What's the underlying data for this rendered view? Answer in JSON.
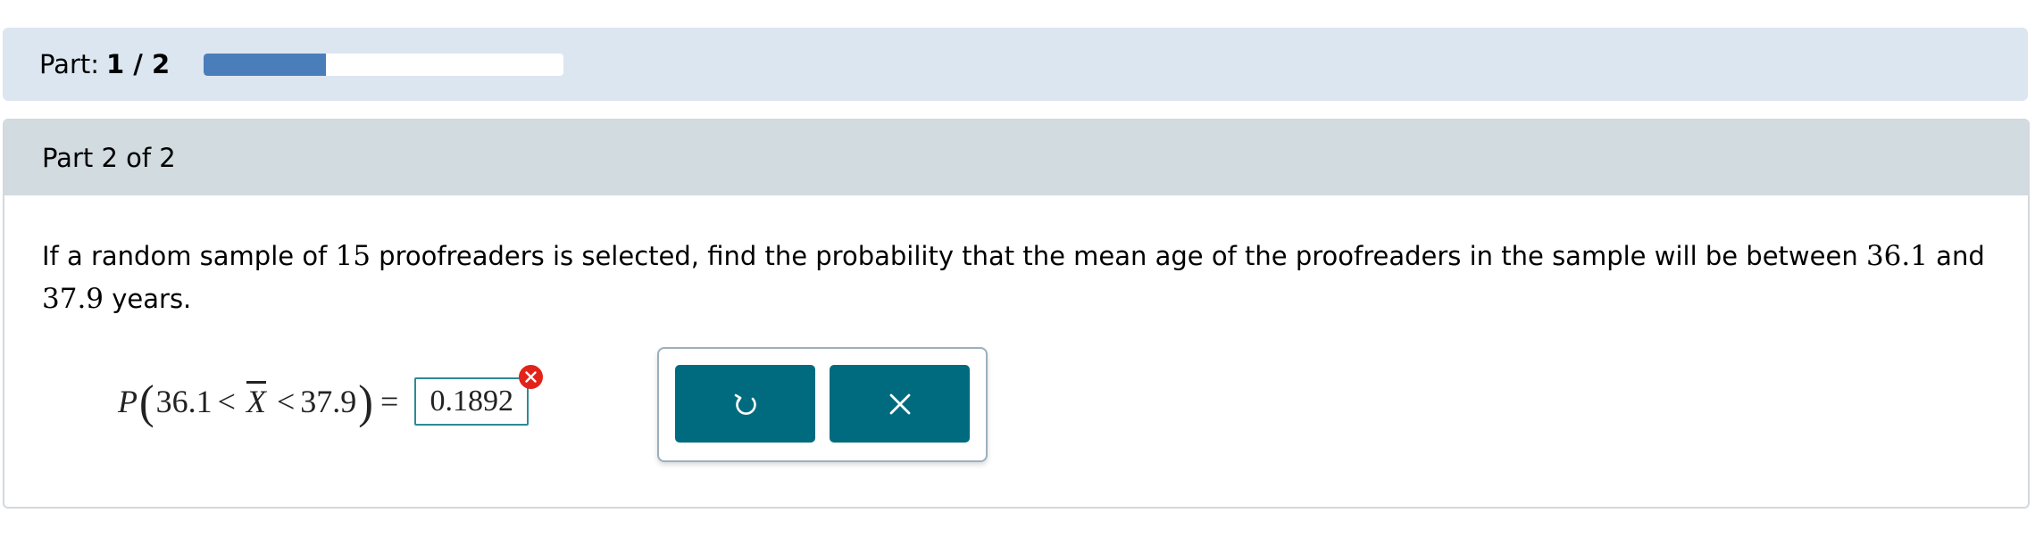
{
  "progress": {
    "part_prefix": "Part:",
    "part_value": "1 / 2",
    "fill_fraction": 0.34,
    "fill_color": "#4a7ebb"
  },
  "card": {
    "header": "Part 2 of 2",
    "question": {
      "t1": "If a random sample of ",
      "n": "15",
      "t2": " proofreaders is selected, find the probability that the mean age of the proofreaders in the sample will be between ",
      "a": "36.1",
      "t3": " and ",
      "b": "37.9",
      "t4": " years."
    }
  },
  "expression": {
    "p": "P",
    "open": "(",
    "low": "36.1",
    "lt1": "<",
    "var": "X",
    "lt2": "<",
    "high": "37.9",
    "close": ")",
    "eq": "=",
    "answer": "0.1892",
    "answer_status": "incorrect"
  },
  "actions": {
    "undo_icon": "undo-icon",
    "clear_icon": "close-icon",
    "button_color": "#006b7f"
  },
  "colors": {
    "error": "#e2231a",
    "input_border": "#2e8a96"
  }
}
